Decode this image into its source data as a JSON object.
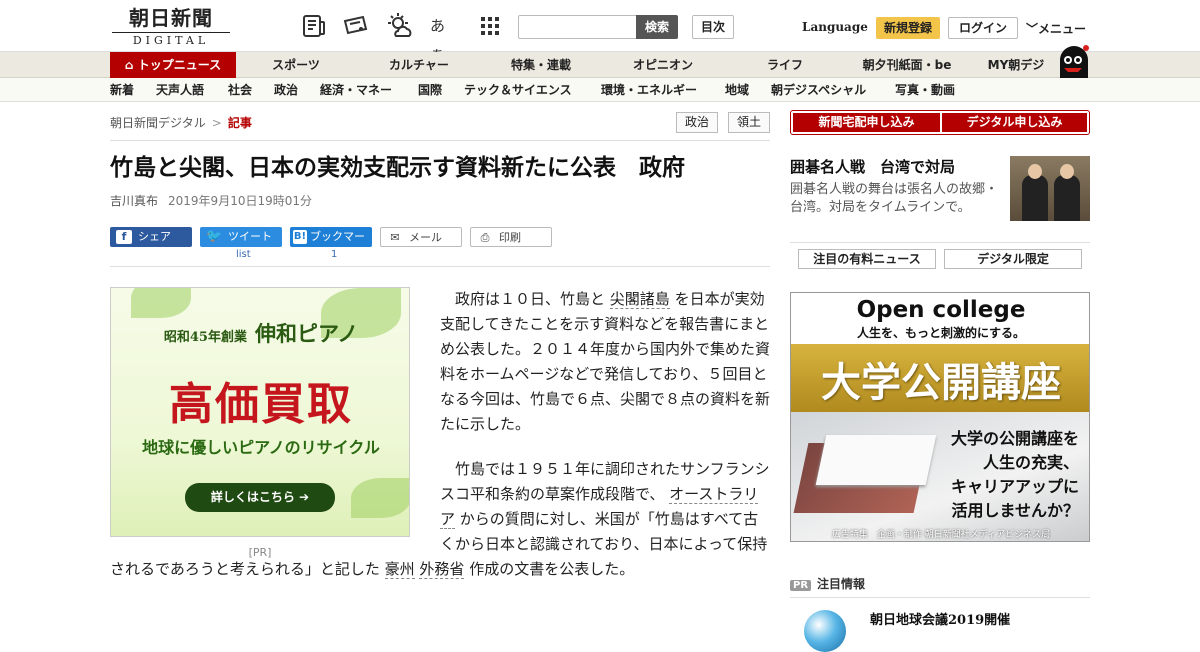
{
  "header": {
    "logo_jp": "朝日新聞",
    "logo_en": "DIGITAL",
    "icons": [
      "newspaper-icon",
      "mail-coupon-icon",
      "weather-icon",
      "font-size-icon",
      "grid-icon"
    ],
    "font_size_label": "あぁ",
    "search_placeholder": "",
    "search_button": "検索",
    "index_button": "目次",
    "language": "Language",
    "register": "新規登録",
    "login": "ログイン",
    "menu": "メニュー"
  },
  "nav_main": [
    "トップニュース",
    "スポーツ",
    "カルチャー",
    "特集・連載",
    "オピニオン",
    "ライフ",
    "朝夕刊紙面・be",
    "MY朝デジ"
  ],
  "nav_sub": [
    "新着",
    "天声人語",
    "社会",
    "政治",
    "経済・マネー",
    "国際",
    "テック＆サイエンス",
    "環境・エネルギー",
    "地域",
    "朝デジスペシャル",
    "写真・動画"
  ],
  "breadcrumb": {
    "root": "朝日新聞デジタル",
    "sep": ">",
    "current": "記事"
  },
  "tags": [
    "政治",
    "領土"
  ],
  "article": {
    "title": "竹島と尖閣、日本の実効支配示す資料新たに公表　政府",
    "author": "吉川真布",
    "date": "2019年9月10日19時01分",
    "p1_a": "政府は１０日、竹島と ",
    "p1_link": "尖閣諸島",
    "p1_b": " を日本が実効支配してきたことを示す資料などを報告書にまとめ公表した。２０１４年度から国内外で集めた資料をホームページなどで発信しており、５回目となる今回は、竹島で６点、尖閣で８点の資料を新たに示した。",
    "p2_a": "竹島では１９５１年に調印されたサンフランシスコ平和条約の草案作成段階で、 ",
    "p2_link1": "オーストラリア",
    "p2_b": " からの質問に対し、米国が「竹島はすべて古くから日本と認識されており、日本によって保持されるであろうと考えられる」と記した ",
    "p2_link2": "豪州",
    "p2_c": " ",
    "p2_link3": "外務省",
    "p2_d": " 作成の文書を公表した。"
  },
  "share": {
    "facebook": "シェア",
    "twitter": "ツイート",
    "hatena": "ブックマーク",
    "mail": "メール",
    "print": "印刷",
    "twitter_count": "list",
    "hatena_count": "1"
  },
  "ad_piano": {
    "line1a": "昭和45年創業",
    "line1b": "伸和ピアノ",
    "line2": "高価買取",
    "line3": "地球に優しいピアノのリサイクル",
    "button": "詳しくはこちら ➔",
    "pr": "[PR]"
  },
  "right": {
    "btn_home": "新聞宅配申し込み",
    "btn_digital": "デジタル申し込み",
    "go_title": "囲碁名人戦　台湾で対局",
    "go_text": "囲碁名人戦の舞台は張名人の故郷・台湾。対局をタイムラインで。",
    "tab1": "注目の有料ニュース",
    "tab2": "デジタル限定",
    "oc_h1": "Open college",
    "oc_h2": "人生を、もっと刺激的にする。",
    "oc_band": "大学公開講座",
    "oc_txt": "大学の公開講座を\n人生の充実、\nキャリアアップに\n活用しませんか？",
    "oc_foot": "広告特集　企画・制作 朝日新聞社メディアビジネス局",
    "pr_label": "PR",
    "pr_header": "注目情報",
    "pr_title": "朝日地球会議2019開催"
  },
  "colors": {
    "brand_red": "#b40000",
    "register_yellow": "#f3c44a",
    "twitter": "#2b8ce0",
    "facebook": "#2d5a9e",
    "hatena": "#1e7fd6"
  }
}
